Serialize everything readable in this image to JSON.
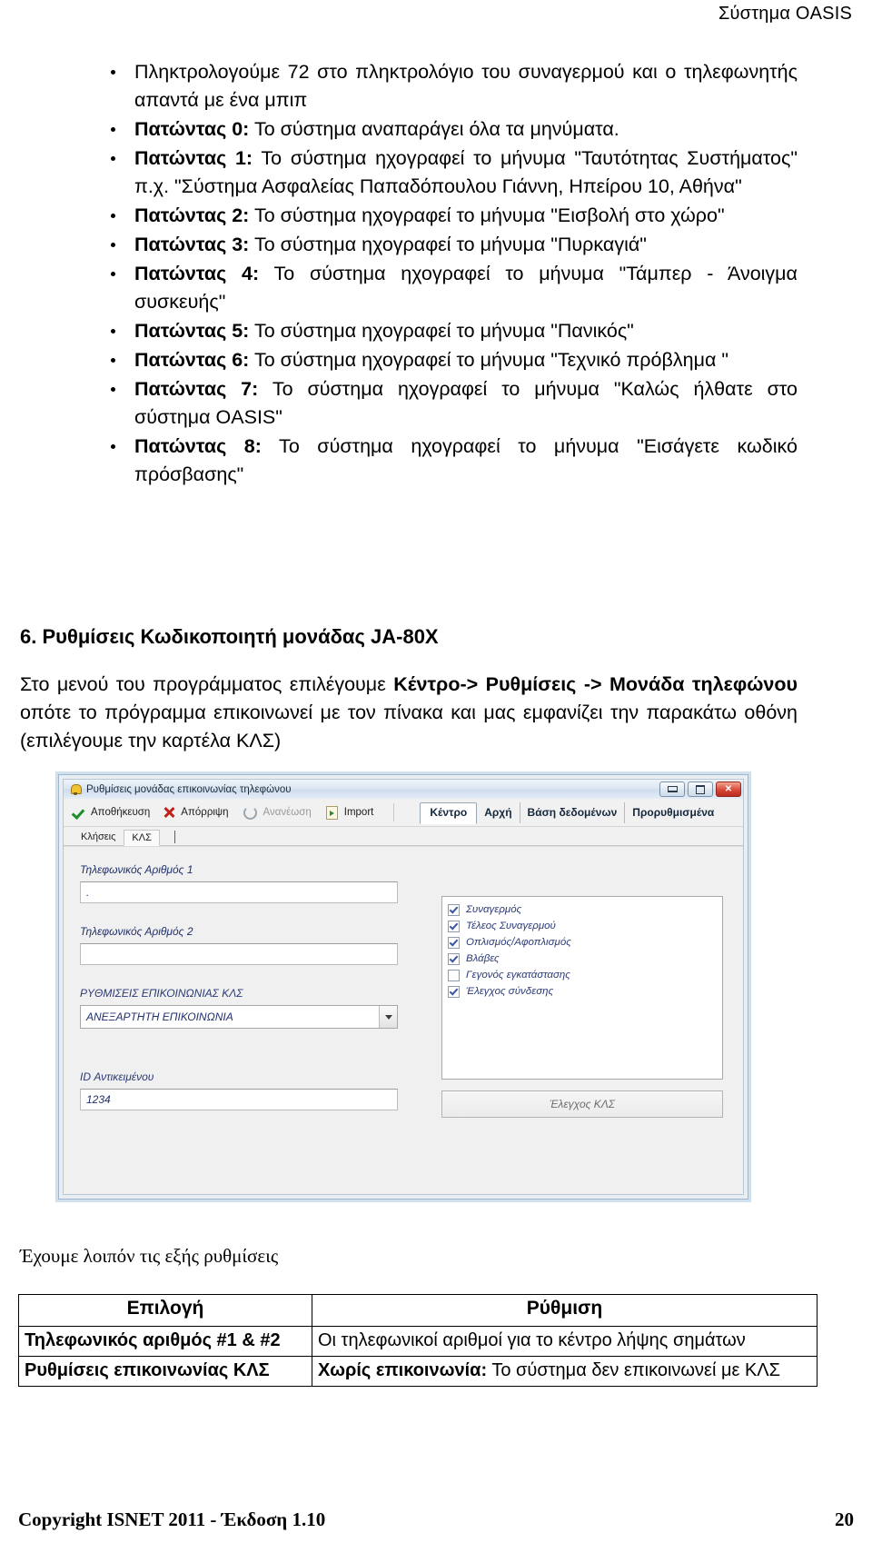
{
  "header": {
    "title": "Σύστημα OASIS"
  },
  "bullets": [
    {
      "lead": "",
      "text": "Πληκτρολογούμε 72 στο πληκτρολόγιο του συναγερμού και ο τηλεφωνητής απαντά με ένα μπιπ"
    },
    {
      "lead": "Πατώντας 0:",
      "text": " Το σύστημα αναπαράγει όλα τα μηνύματα."
    },
    {
      "lead": "Πατώντας 1:",
      "text": " Το σύστημα ηχογραφεί το μήνυμα \"Ταυτότητας Συστήματος\" π.χ. \"Σύστημα Ασφαλείας Παπαδόπουλου Γιάννη, Ηπείρου 10, Αθήνα\""
    },
    {
      "lead": "Πατώντας 2:",
      "text": " Το σύστημα ηχογραφεί το μήνυμα \"Εισβολή στο χώρο\""
    },
    {
      "lead": "Πατώντας 3:",
      "text": " Το σύστημα ηχογραφεί το μήνυμα \"Πυρκαγιά\""
    },
    {
      "lead": "Πατώντας 4:",
      "text": " Το σύστημα ηχογραφεί το μήνυμα \"Τάμπερ - Άνοιγμα συσκευής\""
    },
    {
      "lead": "Πατώντας 5:",
      "text": " Το σύστημα ηχογραφεί το μήνυμα \"Πανικός\""
    },
    {
      "lead": "Πατώντας 6:",
      "text": " Το σύστημα ηχογραφεί το μήνυμα \"Τεχνικό πρόβλημα \""
    },
    {
      "lead": "Πατώντας 7:",
      "text": " Το σύστημα ηχογραφεί το μήνυμα \"Καλώς ήλθατε στο σύστημα OASIS\""
    },
    {
      "lead": "Πατώντας 8:",
      "text": " Το σύστημα ηχογραφεί το μήνυμα \"Εισάγετε κωδικό πρόσβασης\""
    }
  ],
  "section": {
    "heading": "6. Ρυθμίσεις Κωδικοποιητή μονάδας JA-80X"
  },
  "intro": {
    "part1": "Στο μενού του προγράμματος επιλέγουμε ",
    "bold1": "Κέντρο-> Ρυθμίσεις -> Μονάδα τηλεφώνου",
    "part2": " οπότε το πρόγραμμα επικοινωνεί με τον πίνακα και μας εμφανίζει την παρακάτω οθόνη (επιλέγουμε την καρτέλα ΚΛΣ)"
  },
  "app_window": {
    "title": "Ρυθμίσεις μονάδας επικοινωνίας τηλεφώνου",
    "title_icon": "bell-icon",
    "window_buttons": [
      {
        "name": "minimize-button",
        "glyph": ""
      },
      {
        "name": "maximize-button",
        "glyph": ""
      },
      {
        "name": "close-button",
        "glyph": "✕"
      }
    ],
    "toolbar": [
      {
        "label": "Αποθήκευση",
        "icon": "check-icon",
        "disabled": false
      },
      {
        "label": "Απόρριψη",
        "icon": "x-icon",
        "disabled": false
      },
      {
        "label": "Ανανέωση",
        "icon": "refresh-icon",
        "disabled": true
      },
      {
        "label": "Import",
        "icon": "import-icon",
        "disabled": false
      }
    ],
    "top_tabs": [
      {
        "label": "Κέντρο",
        "active": true
      },
      {
        "label": "Αρχή",
        "active": false
      },
      {
        "label": "Βάση δεδομένων",
        "active": false
      },
      {
        "label": "Προρυθμισμένα",
        "active": false
      }
    ],
    "sub_tabs": [
      {
        "label": "Κλήσεις",
        "active": false
      },
      {
        "label": "ΚΛΣ",
        "active": true
      }
    ],
    "fields": {
      "phone1_label": "Τηλεφωνικός Αριθμός 1",
      "phone1_value": ".",
      "phone2_label": "Τηλεφωνικός Αριθμός 2",
      "phone2_value": "",
      "comm_settings_label": "ΡΥΘΜΙΣΕΙΣ ΕΠΙΚΟΙΝΩΝΙΑΣ ΚΛΣ",
      "comm_settings_value": "ΑΝΕΞΑΡΤΗΤΗ ΕΠΙΚΟΙΝΩΝΙΑ",
      "object_id_label": "ID Αντικειμένου",
      "object_id_value": "1234"
    },
    "events": [
      {
        "label": "Συναγερμός",
        "checked": true
      },
      {
        "label": "Τέλεος Συναγερμού",
        "checked": true
      },
      {
        "label": "Οπλισμός/Αφοπλισμός",
        "checked": true
      },
      {
        "label": "Βλάβες",
        "checked": true
      },
      {
        "label": "Γεγονός εγκατάστασης",
        "checked": false
      },
      {
        "label": "Έλεγχος σύνδεσης",
        "checked": true
      }
    ],
    "test_button": "Έλεγχος ΚΛΣ"
  },
  "after_note": "Έχουμε λοιπόν τις εξής ρυθμίσεις",
  "table": {
    "headers": [
      "Επιλογή",
      "Ρύθμιση"
    ],
    "rows": [
      {
        "option": "Τηλεφωνικός αριθμός #1 & #2",
        "value_bold": "",
        "value": "Οι τηλεφωνικοί αριθμοί για το κέντρο λήψης σημάτων"
      },
      {
        "option": "Ρυθμίσεις επικοινωνίας ΚΛΣ",
        "value_bold": "Χωρίς επικοινωνία:",
        "value": " Το σύστημα δεν επικοινωνεί με ΚΛΣ"
      }
    ]
  },
  "footer": {
    "copyright": "Copyright ISNET 2011 - Έκδοση 1.10",
    "page_number": "20"
  }
}
